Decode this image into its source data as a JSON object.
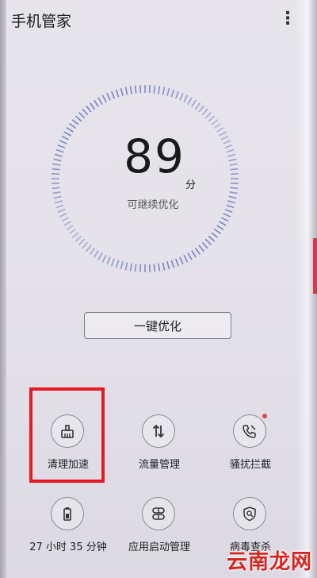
{
  "header": {
    "title": "手机管家",
    "more_icon": "⋮"
  },
  "score": {
    "value": "89",
    "unit": "分",
    "caption": "可继续优化"
  },
  "optimize_button": {
    "label": "一键优化"
  },
  "tools": [
    {
      "label": "清理加速",
      "icon": "broom-icon"
    },
    {
      "label": "流量管理",
      "icon": "data-arrows-icon"
    },
    {
      "label": "骚扰拦截",
      "icon": "phone-block-icon"
    },
    {
      "label": "27 小时 35 分钟",
      "icon": "battery-icon"
    },
    {
      "label": "应用启动管理",
      "icon": "app-launch-icon"
    },
    {
      "label": "病毒查杀",
      "icon": "virus-scan-icon"
    }
  ],
  "watermark": "云南龙网",
  "colors": {
    "highlight": "#e51b23",
    "dial_ticks": "#6f7ec4",
    "badge": "#e04553"
  }
}
